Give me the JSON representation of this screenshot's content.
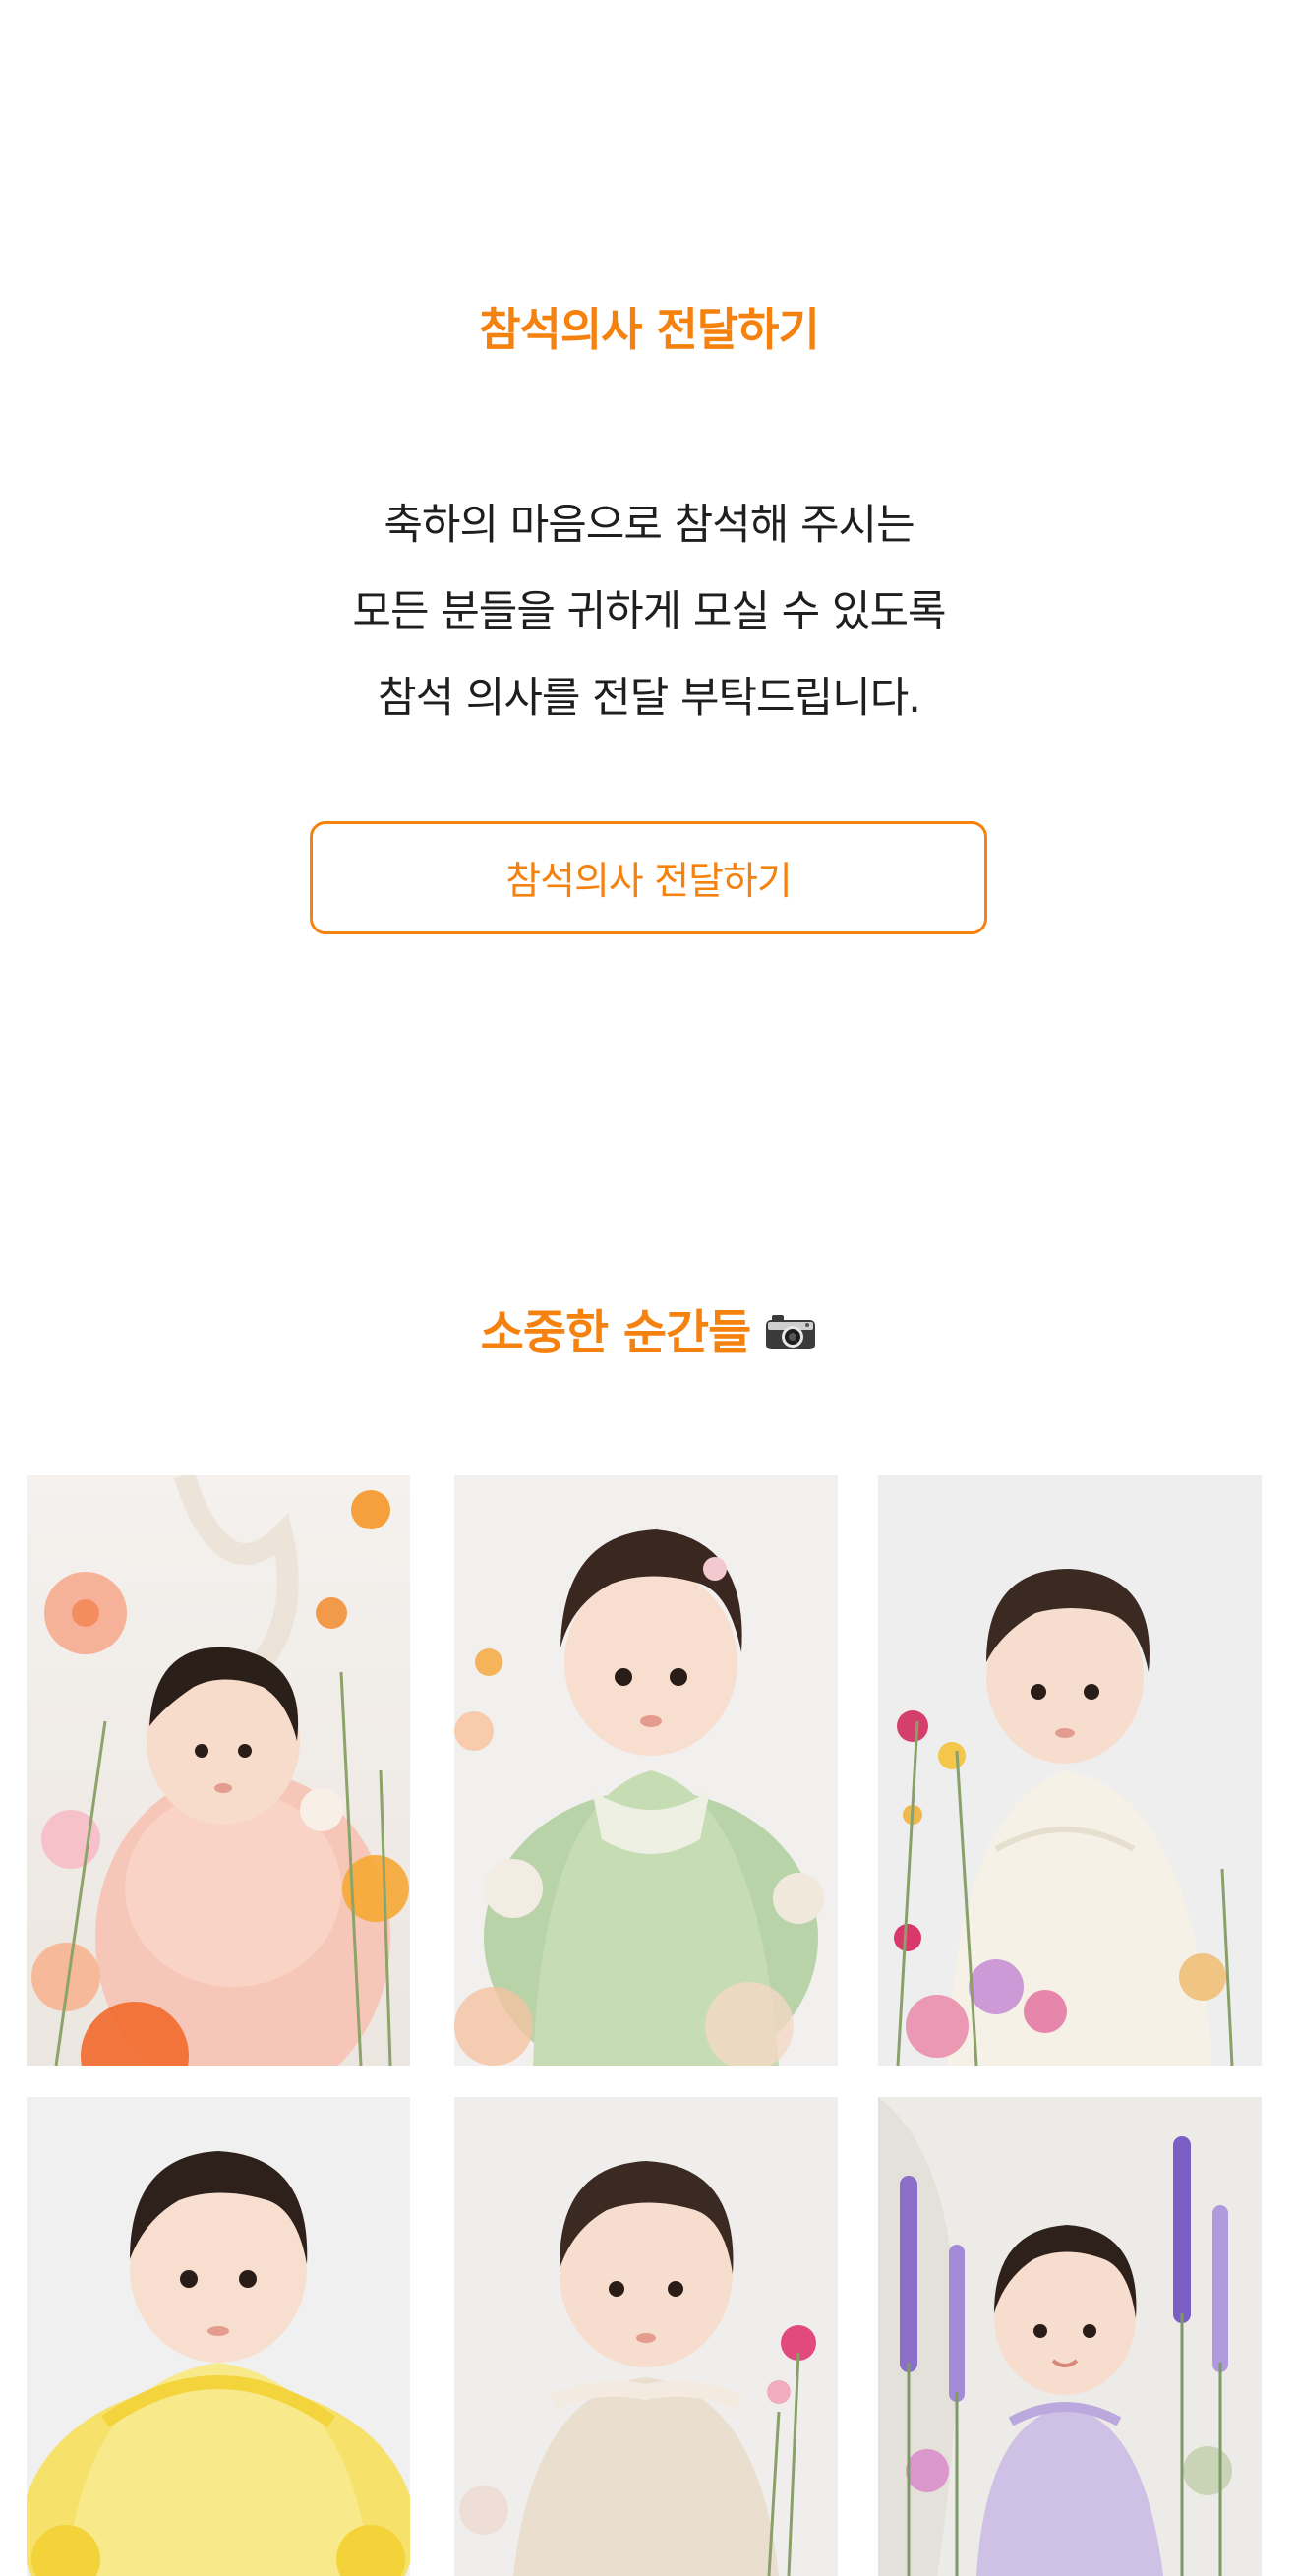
{
  "rsvp": {
    "title": "참석의사 전달하기",
    "lines": [
      "축하의 마음으로 참석해 주시는",
      "모든 분들을 귀하게 모실 수 있도록",
      "참석 의사를 전달 부탁드립니다."
    ],
    "button_label": "참석의사 전달하기"
  },
  "gallery": {
    "title": "소중한 순간들",
    "title_icon": "camera-icon",
    "photos": [
      {
        "name": "gallery-photo-1",
        "outfit": "peach-tulle-dress",
        "flowers": "peach-orange"
      },
      {
        "name": "gallery-photo-2",
        "outfit": "mint-green-dress",
        "flowers": "orange-white"
      },
      {
        "name": "gallery-photo-3",
        "outfit": "white-blouse",
        "flowers": "pink-purple"
      },
      {
        "name": "gallery-photo-4",
        "outfit": "yellow-tulle-dress",
        "flowers": "none"
      },
      {
        "name": "gallery-photo-5",
        "outfit": "beige-ruffle-dress",
        "flowers": "pink-cosmos"
      },
      {
        "name": "gallery-photo-6",
        "outfit": "lavender-dress",
        "flowers": "purple-lupine"
      }
    ]
  },
  "colors": {
    "accent": "#f5820f",
    "text": "#1e1e1e",
    "background": "#ffffff"
  }
}
